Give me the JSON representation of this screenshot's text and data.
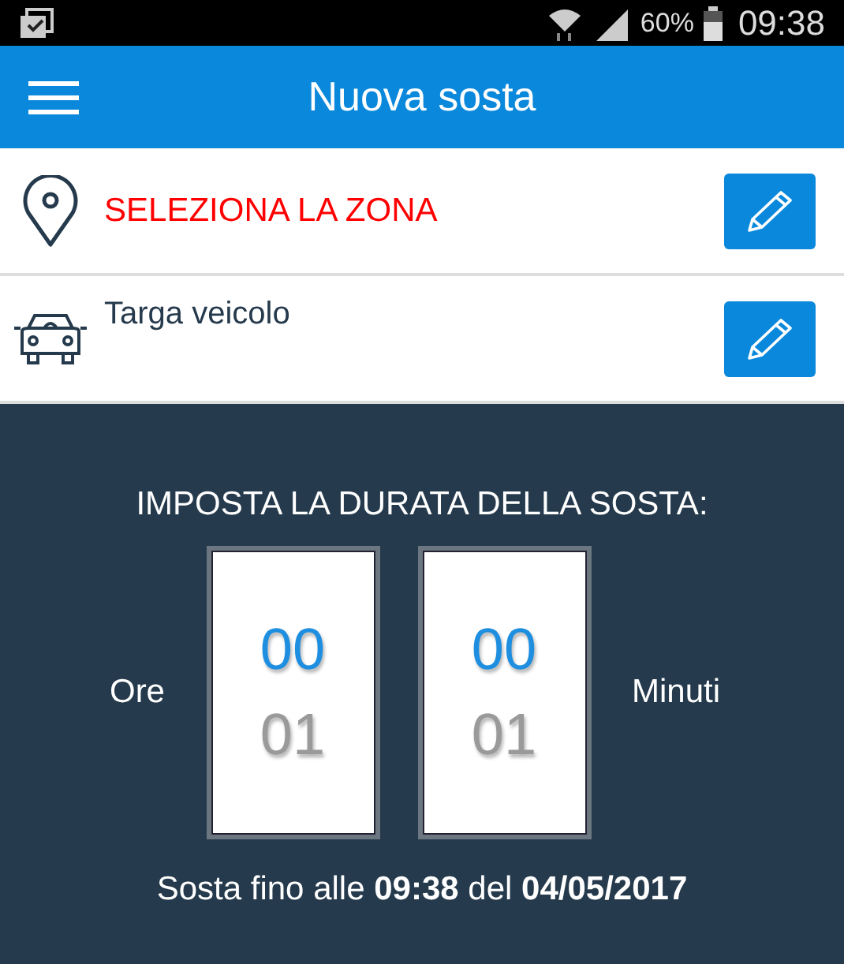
{
  "status_bar": {
    "battery": "60%",
    "time": "09:38"
  },
  "app_bar": {
    "title": "Nuova sosta"
  },
  "rows": [
    {
      "kind": "zone",
      "label": "SELEZIONA LA ZONA"
    },
    {
      "kind": "vehicle",
      "label": "Targa veicolo"
    }
  ],
  "duration": {
    "heading": "IMPOSTA LA DURATA DELLA SOSTA:",
    "left_label": "Ore",
    "right_label": "Minuti",
    "pickers": [
      {
        "items": [
          {
            "value": "00",
            "selected": true
          },
          {
            "value": "01",
            "selected": false
          }
        ]
      },
      {
        "items": [
          {
            "value": "00",
            "selected": true
          },
          {
            "value": "01",
            "selected": false
          }
        ]
      }
    ],
    "summary": "Sosta fino alle **09:38** del **04/05/2017**"
  }
}
